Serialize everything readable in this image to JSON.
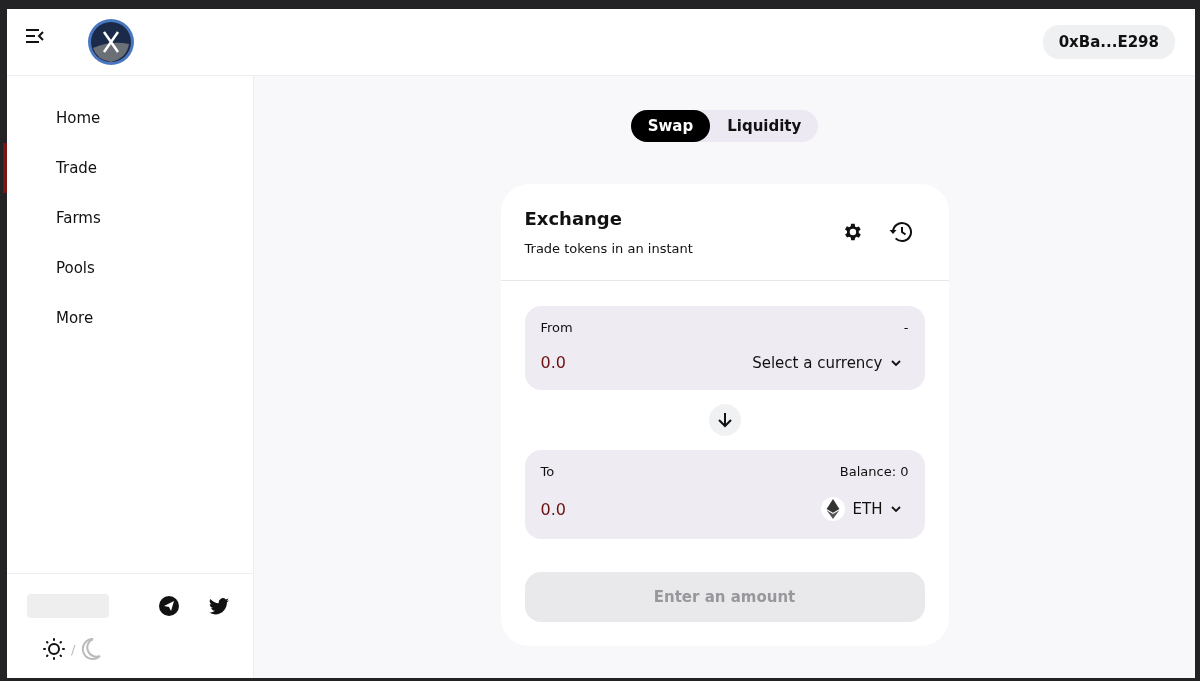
{
  "header": {
    "wallet": "0xBa...E298"
  },
  "sidebar": {
    "items": [
      {
        "label": "Home",
        "selected": false
      },
      {
        "label": "Trade",
        "selected": true
      },
      {
        "label": "Farms",
        "selected": false
      },
      {
        "label": "Pools",
        "selected": false
      },
      {
        "label": "More",
        "selected": false
      }
    ],
    "theme": {
      "separator": "/",
      "dark": false
    }
  },
  "tabs": [
    {
      "label": "Swap",
      "selected": true
    },
    {
      "label": "Liquidity",
      "selected": false
    }
  ],
  "exchange": {
    "title": "Exchange",
    "subtitle": "Trade tokens in an instant",
    "from": {
      "label": "From",
      "balance": "-",
      "placeholder": "0.0",
      "currency": "Select a currency",
      "token": false
    },
    "to": {
      "label": "To",
      "balance": "Balance: 0",
      "placeholder": "0.0",
      "currency": "ETH",
      "token": true
    },
    "button": {
      "label": "Enter an amount",
      "disabled": true
    }
  }
}
